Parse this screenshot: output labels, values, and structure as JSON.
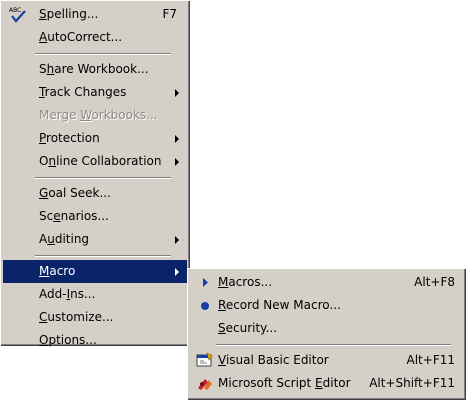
{
  "tools_menu": {
    "items": [
      {
        "pre": "",
        "u": "S",
        "post": "pelling...",
        "shortcut": "F7",
        "icon": "spelling-icon"
      },
      {
        "pre": "",
        "u": "A",
        "post": "utoCorrect..."
      },
      {
        "pre": "S",
        "u": "h",
        "post": "are Workbook..."
      },
      {
        "pre": "",
        "u": "T",
        "post": "rack Changes"
      },
      {
        "pre": "Merge ",
        "u": "W",
        "post": "orkbooks..."
      },
      {
        "pre": "",
        "u": "P",
        "post": "rotection"
      },
      {
        "pre": "O",
        "u": "n",
        "post": "line Collaboration"
      },
      {
        "pre": "",
        "u": "G",
        "post": "oal Seek..."
      },
      {
        "pre": "Sc",
        "u": "e",
        "post": "narios..."
      },
      {
        "pre": "A",
        "u": "u",
        "post": "diting"
      },
      {
        "pre": "",
        "u": "M",
        "post": "acro"
      },
      {
        "pre": "Add-",
        "u": "I",
        "post": "ns..."
      },
      {
        "pre": "",
        "u": "C",
        "post": "ustomize..."
      },
      {
        "pre": "",
        "u": "O",
        "post": "ptions..."
      }
    ]
  },
  "macro_submenu": {
    "items": [
      {
        "pre": "",
        "u": "M",
        "post": "acros...",
        "shortcut": "Alt+F8",
        "icon": "play-macro-icon"
      },
      {
        "pre": "",
        "u": "R",
        "post": "ecord New Macro...",
        "icon": "record-icon"
      },
      {
        "pre": "",
        "u": "S",
        "post": "ecurity..."
      },
      {
        "pre": "",
        "u": "V",
        "post": "isual Basic Editor",
        "shortcut": "Alt+F11",
        "icon": "visual-basic-icon"
      },
      {
        "pre": "Microsoft Script ",
        "u": "E",
        "post": "ditor",
        "shortcut": "Alt+Shift+F11",
        "icon": "script-editor-icon"
      }
    ]
  },
  "colors": {
    "menu_bg": "#d4d0c8",
    "highlight": "#0a246a",
    "disabled_text": "#8d8b86"
  }
}
